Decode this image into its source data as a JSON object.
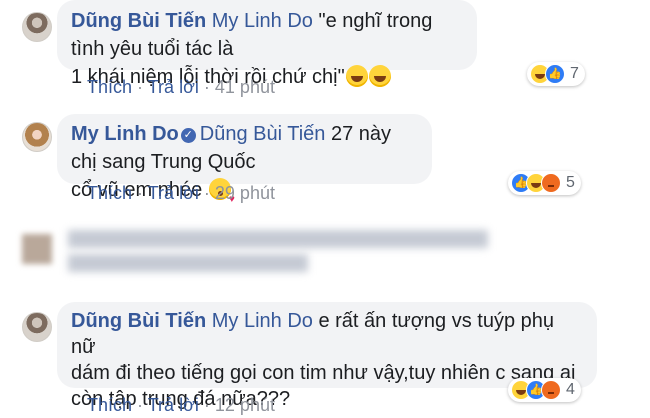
{
  "comments": [
    {
      "author": "Dũng Bùi Tiến",
      "mention": "My Linh Do",
      "text_line1": "\"e nghĩ trong tình yêu tuổi tác là",
      "text_line2": "1 khái niệm lỗi thời rồi chứ chị\"",
      "emoji": "grin-emoji",
      "like_label": "Thích",
      "reply_label": "Trả lời",
      "time": "41 phút",
      "reaction_count": "7",
      "reactions": [
        "haha",
        "like"
      ]
    },
    {
      "author": "My Linh Do",
      "mention": "Dũng Bùi Tiến",
      "text_line1": "27 này chị sang Trung Quốc",
      "text_line2": "cổ vũ em nhée",
      "emoji": "kiss-emoji",
      "like_label": "Thích",
      "reply_label": "Trả lời",
      "time": "29 phút",
      "reaction_count": "5",
      "reactions": [
        "like",
        "haha",
        "angry"
      ]
    },
    {
      "author": "Dũng Bùi Tiến",
      "mention": "My Linh Do",
      "text_line1": "e rất ấn tượng vs tuýp phụ nữ",
      "text_line2": "dám đi theo tiếng gọi con tim như vậy,tuy nhiên c sang ai",
      "text_line3": "còn tập trung đá nữa???",
      "like_label": "Thích",
      "reply_label": "Trả lời",
      "time": "12 phút",
      "reaction_count": "4",
      "reactions": [
        "haha",
        "like",
        "angry"
      ]
    }
  ],
  "separator": "·",
  "colors": {
    "link": "#365899",
    "bubble": "#f2f3f5",
    "meta": "#90949c",
    "like": "#2e7cf6",
    "haha": "#ffd43b",
    "angry": "#ef6a1f"
  }
}
